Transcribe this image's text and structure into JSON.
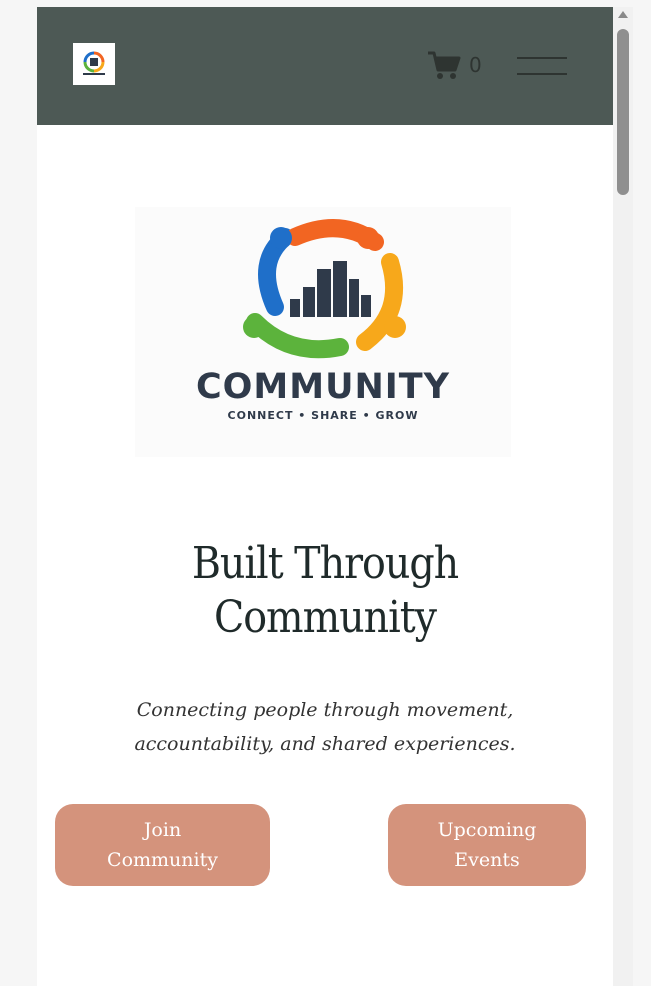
{
  "header": {
    "cart_count": "0"
  },
  "hero": {
    "logo_text": "COMMUNITY",
    "logo_tagline": "CONNECT • SHARE • GROW",
    "title_line1": "Built Through",
    "title_line2": "Community",
    "subtitle_line1": "Connecting people through movement,",
    "subtitle_line2": "accountability, and shared experiences."
  },
  "buttons": {
    "join_line1": "Join",
    "join_line2": "Community",
    "events_line1": "Upcoming",
    "events_line2": "Events"
  },
  "colors": {
    "header_bg": "#4d5955",
    "button_bg": "#d4937c",
    "logo_blue": "#1f6fc9",
    "logo_orange": "#f26522",
    "logo_yellow": "#f7a81b",
    "logo_green": "#5cb33c"
  },
  "icons": [
    "cart-icon",
    "hamburger-menu-icon"
  ]
}
